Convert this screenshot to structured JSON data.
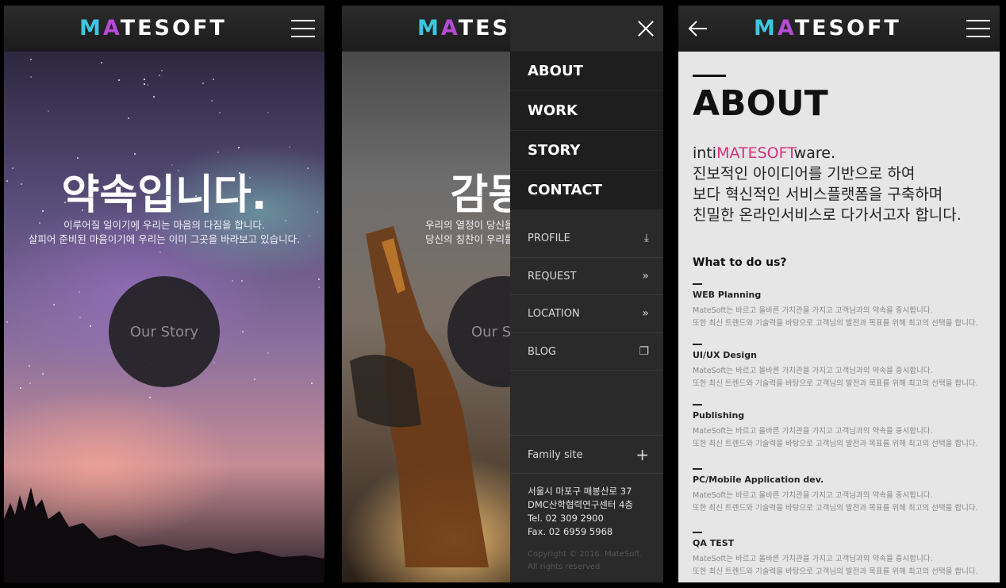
{
  "brand": {
    "logo_text": "MATESOFT"
  },
  "screen1": {
    "hero_title": "약속입니다.",
    "hero_sub_line1": "이루어질 일이기에 우리는 마음의 다짐을 합니다.",
    "hero_sub_line2": "살피어 준비된 마음이기에 우리는 이미 그곳을 바라보고 있습니다.",
    "cta_label": "Our Story"
  },
  "screen2": {
    "hero_title": "감동입",
    "hero_sub_line1": "우리의 열정이 당신을",
    "hero_sub_line2": "당신의 칭찬이 우리를",
    "cta_label": "Our St",
    "menu": {
      "main_items": [
        {
          "label": "ABOUT"
        },
        {
          "label": "WORK"
        },
        {
          "label": "STORY"
        },
        {
          "label": "CONTACT"
        }
      ],
      "sub_items": [
        {
          "label": "PROFILE",
          "icon": "download-icon"
        },
        {
          "label": "REQUEST",
          "icon": "double-chevron-right-icon"
        },
        {
          "label": "LOCATION",
          "icon": "double-chevron-right-icon"
        },
        {
          "label": "BLOG",
          "icon": "external-window-icon"
        }
      ],
      "family_site_label": "Family site",
      "address_line1": "서울시 마포구 매봉산로 37",
      "address_line2": "DMC산학협력연구센터 4층",
      "tel": "Tel. 02 309 2900",
      "fax": "Fax. 02 6959 5968",
      "copyright_line1": "Copyright © 2016. MateSoft.",
      "copyright_line2": "All rights reserved"
    }
  },
  "screen3": {
    "page_title": "ABOUT",
    "lead_prefix": "inti",
    "lead_highlight": "MATESOFT",
    "lead_suffix": "ware.",
    "lead_line2": "진보적인 아이디어를 기반으로 하여",
    "lead_line3": "보다 혁신적인 서비스플랫폼을 구축하며",
    "lead_line4": "친밀한 온라인서비스로 다가서고자 합니다.",
    "section_title": "What to do us?",
    "services": [
      {
        "title": "WEB Planning",
        "desc1": "MateSoft는 바르고 올바른 가치관을 가지고 고객님과의 약속을 중시합니다.",
        "desc2": "또한 최신 트렌드와 기술력을 바탕으로 고객님의 발전과 목표를 위해 최고의 선택을 합니다."
      },
      {
        "title": "UI/UX Design",
        "desc1": "MateSoft는 바르고 올바른 가치관을 가지고 고객님과의 약속을 중시합니다.",
        "desc2": "또한 최신 트렌드와 기술력을 바탕으로 고객님의 발전과 목표를 위해 최고의 선택을 합니다."
      },
      {
        "title": "Publishing",
        "desc1": "MateSoft는 바르고 올바른 가치관을 가지고 고객님과의 약속을 중시합니다.",
        "desc2": "또한 최신 트렌드와 기술력을 바탕으로 고객님의 발전과 목표를 위해 최고의 선택을 합니다."
      },
      {
        "title": "PC/Mobile Application dev.",
        "desc1": "MateSoft는 바르고 올바른 가치관을 가지고 고객님과의 약속을 중시합니다.",
        "desc2": "또한 최신 트렌드와 기술력을 바탕으로 고객님의 발전과 목표를 위해 최고의 선택을 합니다."
      },
      {
        "title": "QA TEST",
        "desc1": "MateSoft는 바르고 올바른 가치관을 가지고 고객님과의 약속을 중시합니다.",
        "desc2": "또한 최신 트렌드와 기술력을 바탕으로 고객님의 발전과 목표를 위해 최고의 선택을 합니다."
      }
    ]
  },
  "colors": {
    "accent_pink": "#d0307d",
    "menu_bg": "#2a2a2a",
    "header_bg": "#222222",
    "page_bg": "#e6e6e6"
  }
}
